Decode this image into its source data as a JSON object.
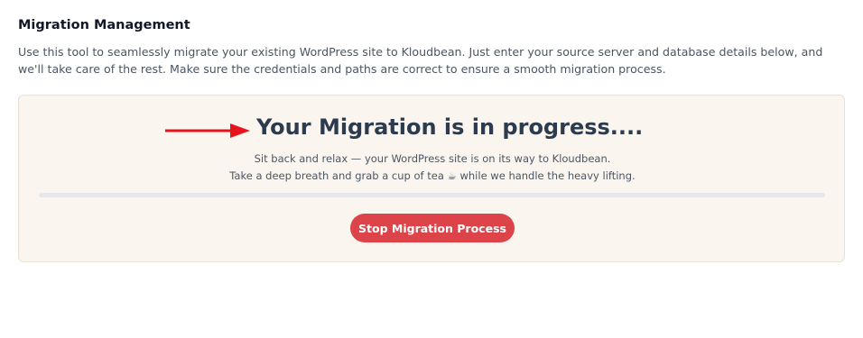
{
  "header": {
    "title": "Migration Management",
    "description": "Use this tool to seamlessly migrate your existing WordPress site to Kloudbean. Just enter your source server and database details below, and we'll take care of the rest. Make sure the credentials and paths are correct to ensure a smooth migration process."
  },
  "status": {
    "title": "Your Migration is in progress....",
    "line1": "Sit back and relax — your WordPress site is on its way to Kloudbean.",
    "line2": "Take a deep breath and grab a cup of tea ☕ while we handle the heavy lifting.",
    "progress_fraction": 0,
    "arrow_icon": "arrow-right-icon",
    "arrow_color": "#e8141b"
  },
  "actions": {
    "stop_label": "Stop Migration Process",
    "stop_color": "#dd4449"
  }
}
